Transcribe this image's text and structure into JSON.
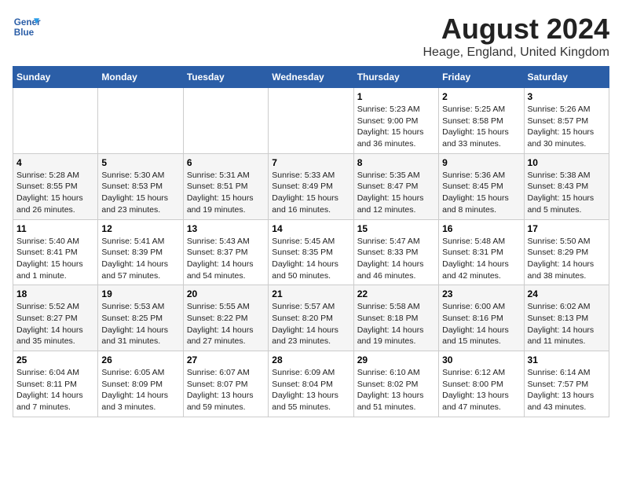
{
  "header": {
    "logo_line1": "General",
    "logo_line2": "Blue",
    "month_year": "August 2024",
    "location": "Heage, England, United Kingdom"
  },
  "weekdays": [
    "Sunday",
    "Monday",
    "Tuesday",
    "Wednesday",
    "Thursday",
    "Friday",
    "Saturday"
  ],
  "weeks": [
    [
      {
        "day": "",
        "info": ""
      },
      {
        "day": "",
        "info": ""
      },
      {
        "day": "",
        "info": ""
      },
      {
        "day": "",
        "info": ""
      },
      {
        "day": "1",
        "info": "Sunrise: 5:23 AM\nSunset: 9:00 PM\nDaylight: 15 hours\nand 36 minutes."
      },
      {
        "day": "2",
        "info": "Sunrise: 5:25 AM\nSunset: 8:58 PM\nDaylight: 15 hours\nand 33 minutes."
      },
      {
        "day": "3",
        "info": "Sunrise: 5:26 AM\nSunset: 8:57 PM\nDaylight: 15 hours\nand 30 minutes."
      }
    ],
    [
      {
        "day": "4",
        "info": "Sunrise: 5:28 AM\nSunset: 8:55 PM\nDaylight: 15 hours\nand 26 minutes."
      },
      {
        "day": "5",
        "info": "Sunrise: 5:30 AM\nSunset: 8:53 PM\nDaylight: 15 hours\nand 23 minutes."
      },
      {
        "day": "6",
        "info": "Sunrise: 5:31 AM\nSunset: 8:51 PM\nDaylight: 15 hours\nand 19 minutes."
      },
      {
        "day": "7",
        "info": "Sunrise: 5:33 AM\nSunset: 8:49 PM\nDaylight: 15 hours\nand 16 minutes."
      },
      {
        "day": "8",
        "info": "Sunrise: 5:35 AM\nSunset: 8:47 PM\nDaylight: 15 hours\nand 12 minutes."
      },
      {
        "day": "9",
        "info": "Sunrise: 5:36 AM\nSunset: 8:45 PM\nDaylight: 15 hours\nand 8 minutes."
      },
      {
        "day": "10",
        "info": "Sunrise: 5:38 AM\nSunset: 8:43 PM\nDaylight: 15 hours\nand 5 minutes."
      }
    ],
    [
      {
        "day": "11",
        "info": "Sunrise: 5:40 AM\nSunset: 8:41 PM\nDaylight: 15 hours\nand 1 minute."
      },
      {
        "day": "12",
        "info": "Sunrise: 5:41 AM\nSunset: 8:39 PM\nDaylight: 14 hours\nand 57 minutes."
      },
      {
        "day": "13",
        "info": "Sunrise: 5:43 AM\nSunset: 8:37 PM\nDaylight: 14 hours\nand 54 minutes."
      },
      {
        "day": "14",
        "info": "Sunrise: 5:45 AM\nSunset: 8:35 PM\nDaylight: 14 hours\nand 50 minutes."
      },
      {
        "day": "15",
        "info": "Sunrise: 5:47 AM\nSunset: 8:33 PM\nDaylight: 14 hours\nand 46 minutes."
      },
      {
        "day": "16",
        "info": "Sunrise: 5:48 AM\nSunset: 8:31 PM\nDaylight: 14 hours\nand 42 minutes."
      },
      {
        "day": "17",
        "info": "Sunrise: 5:50 AM\nSunset: 8:29 PM\nDaylight: 14 hours\nand 38 minutes."
      }
    ],
    [
      {
        "day": "18",
        "info": "Sunrise: 5:52 AM\nSunset: 8:27 PM\nDaylight: 14 hours\nand 35 minutes."
      },
      {
        "day": "19",
        "info": "Sunrise: 5:53 AM\nSunset: 8:25 PM\nDaylight: 14 hours\nand 31 minutes."
      },
      {
        "day": "20",
        "info": "Sunrise: 5:55 AM\nSunset: 8:22 PM\nDaylight: 14 hours\nand 27 minutes."
      },
      {
        "day": "21",
        "info": "Sunrise: 5:57 AM\nSunset: 8:20 PM\nDaylight: 14 hours\nand 23 minutes."
      },
      {
        "day": "22",
        "info": "Sunrise: 5:58 AM\nSunset: 8:18 PM\nDaylight: 14 hours\nand 19 minutes."
      },
      {
        "day": "23",
        "info": "Sunrise: 6:00 AM\nSunset: 8:16 PM\nDaylight: 14 hours\nand 15 minutes."
      },
      {
        "day": "24",
        "info": "Sunrise: 6:02 AM\nSunset: 8:13 PM\nDaylight: 14 hours\nand 11 minutes."
      }
    ],
    [
      {
        "day": "25",
        "info": "Sunrise: 6:04 AM\nSunset: 8:11 PM\nDaylight: 14 hours\nand 7 minutes."
      },
      {
        "day": "26",
        "info": "Sunrise: 6:05 AM\nSunset: 8:09 PM\nDaylight: 14 hours\nand 3 minutes."
      },
      {
        "day": "27",
        "info": "Sunrise: 6:07 AM\nSunset: 8:07 PM\nDaylight: 13 hours\nand 59 minutes."
      },
      {
        "day": "28",
        "info": "Sunrise: 6:09 AM\nSunset: 8:04 PM\nDaylight: 13 hours\nand 55 minutes."
      },
      {
        "day": "29",
        "info": "Sunrise: 6:10 AM\nSunset: 8:02 PM\nDaylight: 13 hours\nand 51 minutes."
      },
      {
        "day": "30",
        "info": "Sunrise: 6:12 AM\nSunset: 8:00 PM\nDaylight: 13 hours\nand 47 minutes."
      },
      {
        "day": "31",
        "info": "Sunrise: 6:14 AM\nSunset: 7:57 PM\nDaylight: 13 hours\nand 43 minutes."
      }
    ]
  ]
}
